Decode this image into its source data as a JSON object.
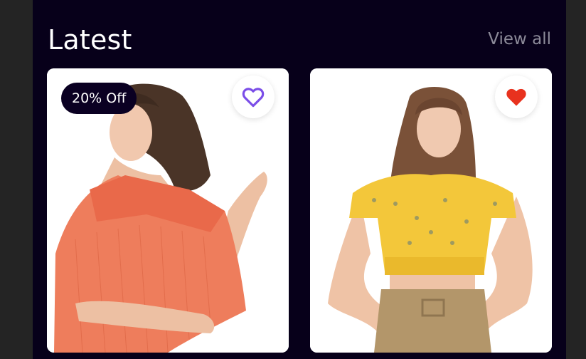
{
  "section": {
    "title": "Latest",
    "view_all": "View all"
  },
  "colors": {
    "background": "#07001a",
    "heart_outline": "#7b4ee8",
    "heart_filled": "#e8321e",
    "badge_bg": "#0a0022"
  },
  "products": [
    {
      "badge": "20% Off",
      "favorite": false,
      "favorite_icon": "heart-outline-icon",
      "image": "woman in coral off-shoulder top"
    },
    {
      "favorite": true,
      "favorite_icon": "heart-filled-icon",
      "image": "woman in yellow floral crop top"
    }
  ]
}
